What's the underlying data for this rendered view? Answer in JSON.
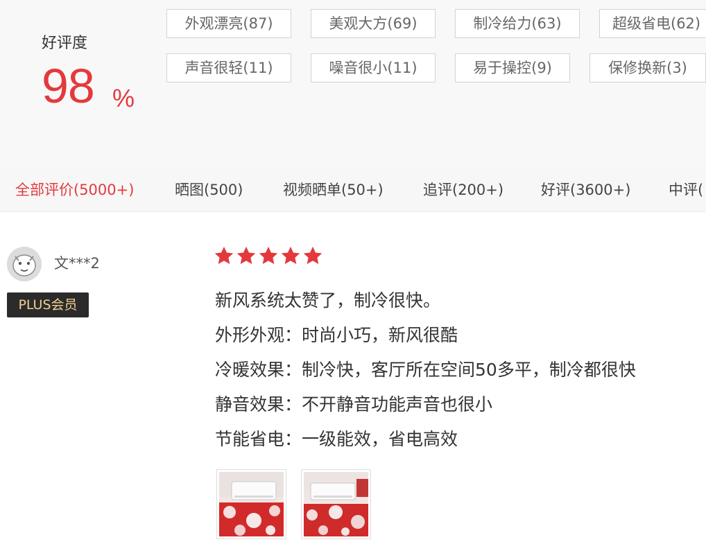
{
  "summary": {
    "rate_label": "好评度",
    "rate_value": "98",
    "rate_unit": "%",
    "tags": [
      "外观漂亮(87)",
      "美观大方(69)",
      "制冷给力(63)",
      "超级省电(62)",
      "声音很轻(11)",
      "噪音很小(11)",
      "易于操控(9)",
      "保修换新(3)"
    ]
  },
  "tabs": [
    "全部评价(5000+)",
    "晒图(500)",
    "视频晒单(50+)",
    "追评(200+)",
    "好评(3600+)",
    "中评("
  ],
  "review": {
    "username": "文***2",
    "badge": "PLUS会员",
    "rating": 5,
    "lines": [
      "新风系统太赞了，制冷很快。",
      "外形外观：时尚小巧，新风很酷",
      "冷暖效果：制冷快，客厅所在空间50多平，制冷都很快",
      "静音效果：不开静音功能声音也很小",
      "节能省电：一级能效，省电高效"
    ]
  },
  "colors": {
    "accent": "#e4393c",
    "star": "#e4393c",
    "badge_bg": "#2b2b2b",
    "badge_text": "#f0d090"
  },
  "icons": {
    "star": "star-icon",
    "avatar": "avatar-face-icon"
  }
}
